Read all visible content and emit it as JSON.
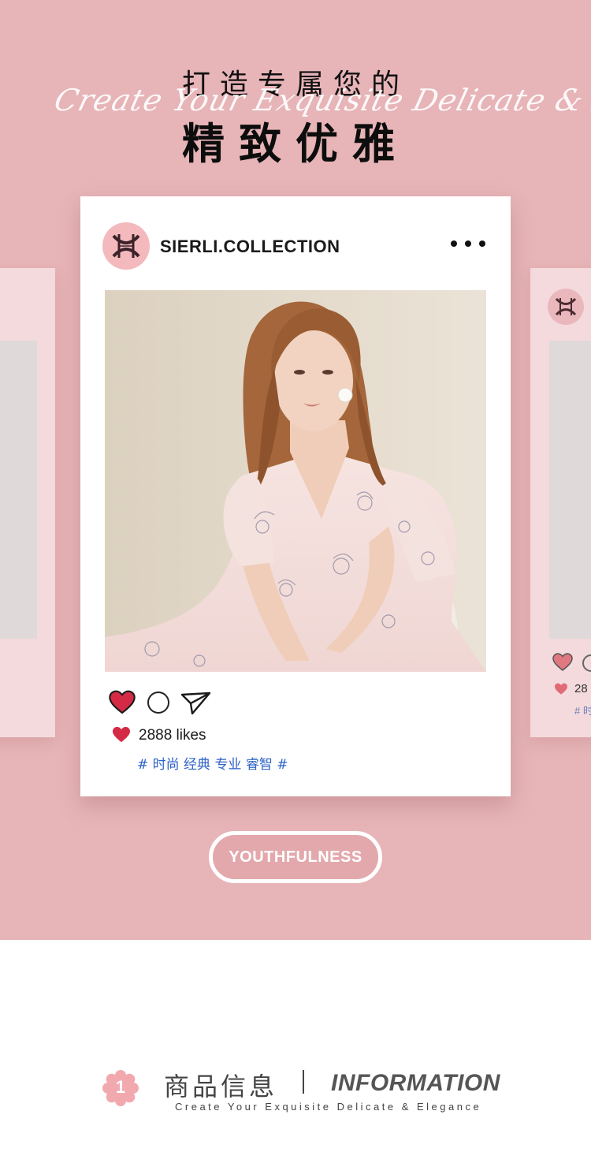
{
  "header": {
    "title_line1": "打造专属您的",
    "script_text": "Create Your Exquisite Delicate & Elegance",
    "title_line2": "精致优雅"
  },
  "post": {
    "username": "SIERLI.COLLECTION",
    "avatar_icon": "brand-logo-icon",
    "more_icon": "more-options-icon",
    "image_alt": "model in pink floral wrap dress",
    "actions": [
      "heart-icon",
      "comment-icon",
      "share-icon"
    ],
    "likes_text": "2888 likes",
    "tags": "# 时尚 经典 专业 睿智 #"
  },
  "side_card_right": {
    "likes_text": "28",
    "tags": "# 时"
  },
  "cta": {
    "label": "YOUTHFULNESS"
  },
  "info": {
    "badge_number": "1",
    "title_cn": "商品信息",
    "title_en": "INFORMATION",
    "subtitle": "Create Your Exquisite Delicate & Elegance"
  },
  "colors": {
    "hero_bg": "#e7b4b7",
    "accent_pink": "#f3b9bd",
    "heart_red": "#d42a46",
    "tag_blue": "#2d62c6"
  }
}
